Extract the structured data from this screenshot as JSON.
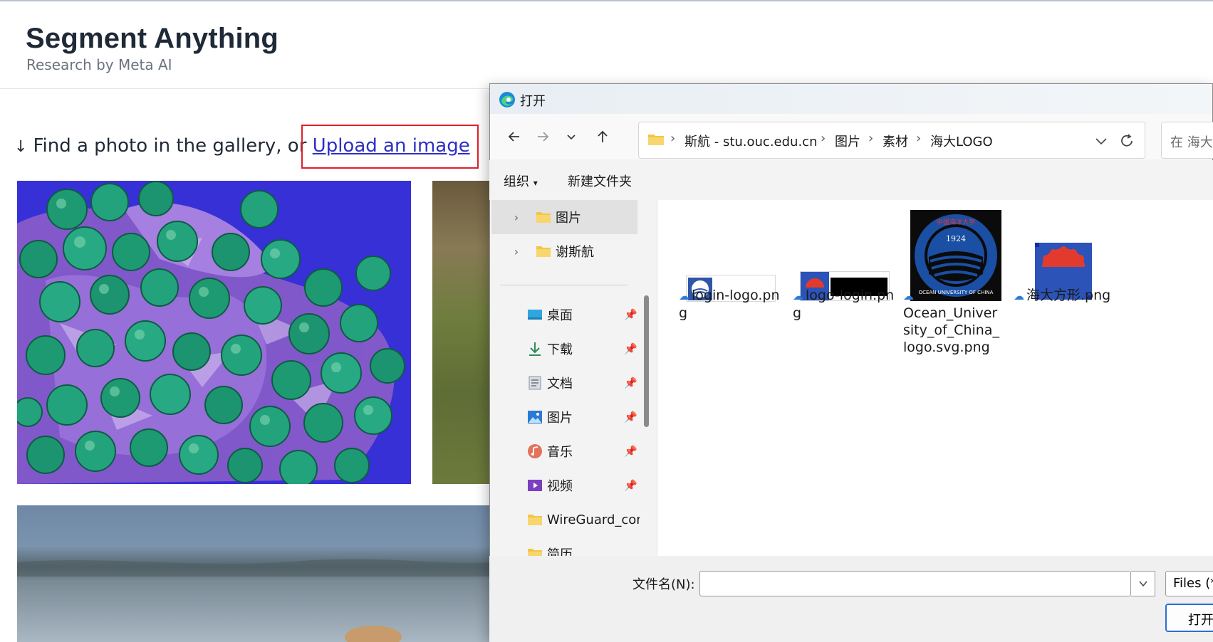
{
  "site": {
    "title": "Segment Anything",
    "subtitle": "Research by Meta AI",
    "prompt_arrow": "↓",
    "prompt_text": "Find a photo in the gallery, or ",
    "upload_link": "Upload an image"
  },
  "dialog": {
    "title": "打开",
    "breadcrumbs": [
      "斯航 - stu.ouc.edu.cn",
      "图片",
      "素材",
      "海大LOGO"
    ],
    "search_placeholder": "在 海大",
    "commands": {
      "organize": "组织",
      "new_folder": "新建文件夹"
    },
    "tree": [
      {
        "label": "图片",
        "type": "folder",
        "selected": true
      },
      {
        "label": "谢斯航",
        "type": "folder"
      }
    ],
    "quick_access": [
      {
        "label": "桌面",
        "icon": "desktop-icon",
        "pinned": true
      },
      {
        "label": "下载",
        "icon": "download-icon",
        "pinned": true
      },
      {
        "label": "文档",
        "icon": "document-icon",
        "pinned": true
      },
      {
        "label": "图片",
        "icon": "pictures-icon",
        "pinned": true
      },
      {
        "label": "音乐",
        "icon": "music-icon",
        "pinned": true
      },
      {
        "label": "视频",
        "icon": "video-icon",
        "pinned": true
      },
      {
        "label": "WireGuard_cor",
        "icon": "folder-icon",
        "pinned": false
      },
      {
        "label": "简历",
        "icon": "folder-icon",
        "pinned": false
      }
    ],
    "files": [
      {
        "name": "login-logo.pn\ng",
        "icon": "cloud-icon"
      },
      {
        "name": "logo-login.pn\ng",
        "icon": "cloud-icon"
      },
      {
        "name": "Ocean_Univer\nsity_of_China_\nlogo.svg.png",
        "icon": "cloud-icon"
      },
      {
        "name": "海大方形.png",
        "icon": "cloud-icon"
      }
    ],
    "logo_text": {
      "year": "1924",
      "ring_text": "OCEAN UNIVERSITY OF CHINA",
      "cn_text": "中国海洋大学"
    },
    "filename_label": "文件名(N):",
    "filename_value": "",
    "filetype": "Files (*.",
    "open_button": "打开"
  },
  "colors": {
    "link": "#2d2fc2",
    "highlight": "#e0202a",
    "accent": "#2b6fd6",
    "folder": "#f3c545"
  }
}
